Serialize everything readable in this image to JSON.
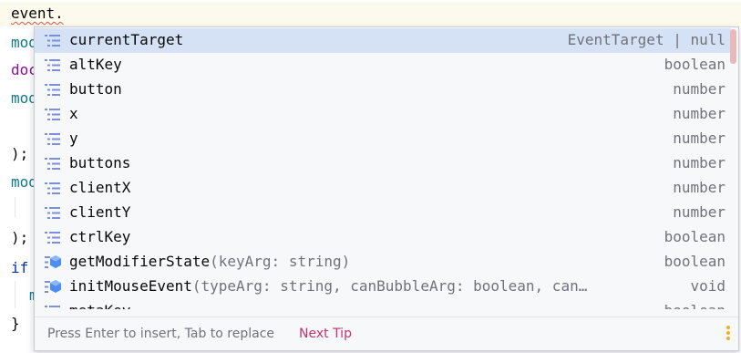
{
  "editor": {
    "line1": "event.",
    "frag_mod1": "mod",
    "frag_doc": "doc",
    "frag_mod2": "mod",
    "frag_close1": ");",
    "frag_mod3": "mod",
    "frag_close2": ");",
    "frag_if": "if",
    "frag_m": "m",
    "frag_brace": "}"
  },
  "popup": {
    "items": [
      {
        "name": "currentTarget",
        "params": "",
        "type": "EventTarget | null",
        "icon": "property-icon"
      },
      {
        "name": "altKey",
        "params": "",
        "type": "boolean",
        "icon": "property-icon"
      },
      {
        "name": "button",
        "params": "",
        "type": "number",
        "icon": "property-icon"
      },
      {
        "name": "x",
        "params": "",
        "type": "number",
        "icon": "property-icon"
      },
      {
        "name": "y",
        "params": "",
        "type": "number",
        "icon": "property-icon"
      },
      {
        "name": "buttons",
        "params": "",
        "type": "number",
        "icon": "property-icon"
      },
      {
        "name": "clientX",
        "params": "",
        "type": "number",
        "icon": "property-icon"
      },
      {
        "name": "clientY",
        "params": "",
        "type": "number",
        "icon": "property-icon"
      },
      {
        "name": "ctrlKey",
        "params": "",
        "type": "boolean",
        "icon": "property-icon"
      },
      {
        "name": "getModifierState",
        "params": "(keyArg: string)",
        "type": "boolean",
        "icon": "method-icon"
      },
      {
        "name": "initMouseEvent",
        "params": "(typeArg: string, canBubbleArg: boolean, can…",
        "type": "void",
        "icon": "method-icon"
      },
      {
        "name": "metaKey",
        "params": "",
        "type": "boolean",
        "icon": "property-icon"
      }
    ],
    "footer_hint": "Press Enter to insert, Tab to replace",
    "footer_tip": "Next Tip"
  },
  "colors": {
    "selection": "#d5e1f5",
    "property_icon": "#7b8ee0",
    "method_icon": "#4d8ef5",
    "tip_link": "#c33370"
  }
}
